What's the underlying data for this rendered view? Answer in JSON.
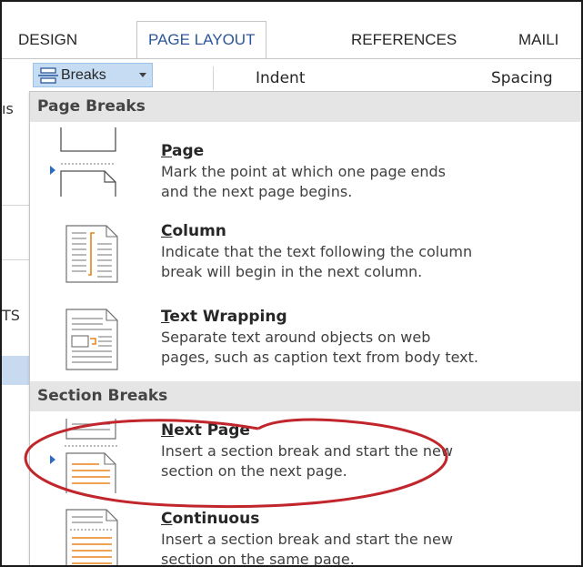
{
  "tabs": [
    {
      "label": "DESIGN",
      "active": false
    },
    {
      "label": "PAGE LAYOUT",
      "active": true
    },
    {
      "label": "REFERENCES",
      "active": false
    },
    {
      "label": "MAILI",
      "active": false
    }
  ],
  "ribbon": {
    "breaks_label": "Breaks",
    "indent_label": "Indent",
    "spacing_label": "Spacing"
  },
  "doc_edge_fragments": [
    "ıs",
    "TS"
  ],
  "menu": {
    "page_breaks_header": "Page Breaks",
    "section_breaks_header": "Section Breaks",
    "items": [
      {
        "title_underline": "P",
        "title_rest": "age",
        "lines": [
          "Mark the point at which one page ends",
          "and the next page begins."
        ],
        "icon": "page-break-icon"
      },
      {
        "title_underline": "C",
        "title_rest": "olumn",
        "lines": [
          "Indicate that the text following the column",
          "break will begin in the next column."
        ],
        "icon": "column-break-icon"
      },
      {
        "title_underline": "T",
        "title_rest": "ext Wrapping",
        "lines": [
          "Separate text around objects on web",
          "pages, such as caption text from body text."
        ],
        "icon": "text-wrapping-icon"
      },
      {
        "title_underline": "N",
        "title_rest": "ext Page",
        "lines": [
          "Insert a section break and start the new",
          "section on the next page."
        ],
        "icon": "next-page-section-icon"
      },
      {
        "title_underline": "C",
        "title_rest": "ontinuous",
        "lines": [
          "Insert a section break and start the new",
          "section on the same page."
        ],
        "icon": "continuous-section-icon"
      }
    ]
  },
  "colors": {
    "accent_blue": "#2b579a",
    "hover_fill": "#c5dcf3",
    "annotation_red": "#c0262c",
    "section_header_bg": "#e5e5e5",
    "icon_orange": "#e8841c"
  }
}
